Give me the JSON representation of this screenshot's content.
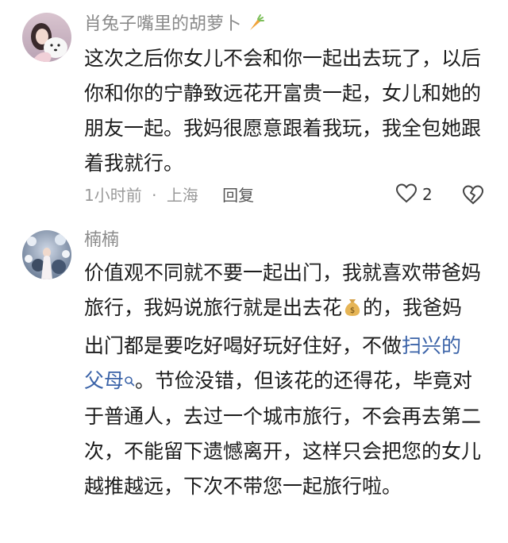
{
  "comments": [
    {
      "username": "肖兔子嘴里的胡萝卜",
      "username_emoji": "carrot-icon",
      "text": "这次之后你女儿不会和你一起出去玩了，以后你和你的宁静致远花开富贵一起，女儿和她的朋友一起。我妈很愿意跟着我玩，我全包她跟着我就行。",
      "time": "1小时前",
      "separator": "·",
      "location": "上海",
      "reply_label": "回复",
      "like_count": "2"
    },
    {
      "username": "楠楠",
      "text_part1": "价值观不同就不要一起出门，我就喜欢带爸妈旅行，我妈说旅行就是出去花",
      "text_emoji": "money-bag-icon",
      "text_part2": "的，我爸妈出门都是要吃好喝好玩好住好，不做",
      "link_text": "扫兴的父母",
      "text_part3": "。节俭没错，但该花的还得花，毕竟对于普通人，去过一个城市旅行，不会再去第二次，不能留下遗憾离开，这样只会把您的女儿越推越远，下次不带您一起旅行啦。"
    }
  ],
  "colors": {
    "link": "#3b63a8",
    "muted": "#8a8a8a",
    "text": "#1c1c1c"
  }
}
